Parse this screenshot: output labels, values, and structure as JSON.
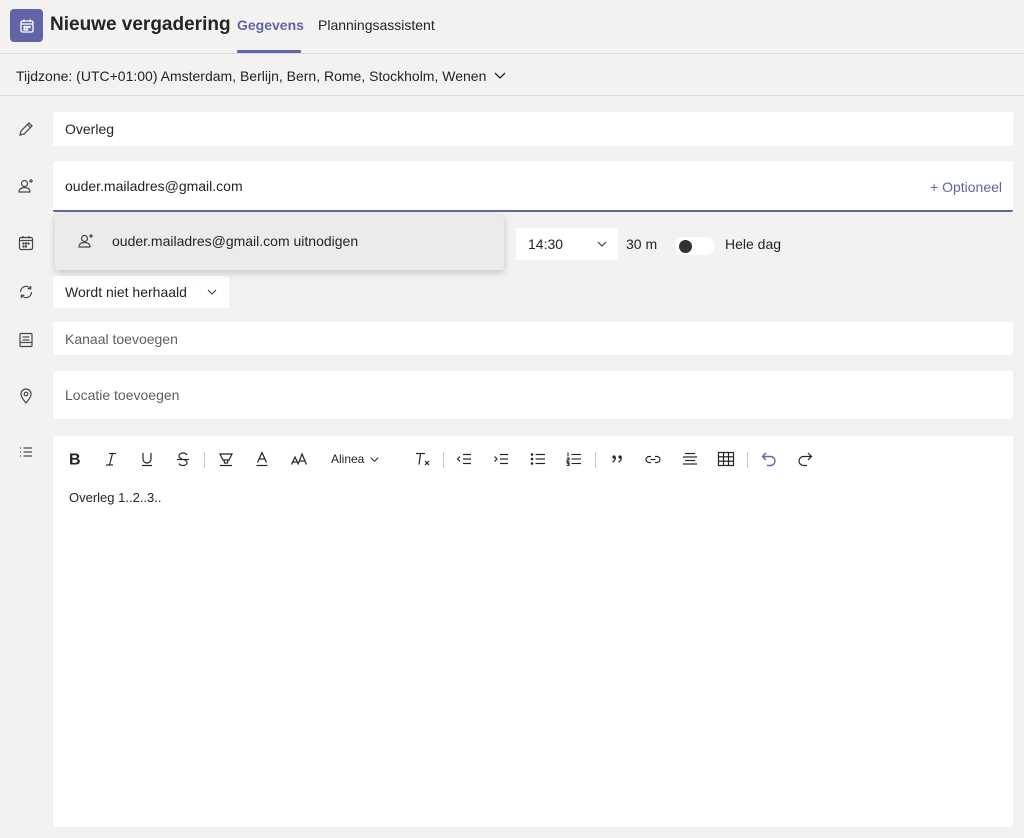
{
  "header": {
    "title": "Nieuwe vergadering",
    "tabs": [
      {
        "label": "Gegevens",
        "active": true
      },
      {
        "label": "Planningsassistent",
        "active": false
      }
    ],
    "accent": "#6264a7"
  },
  "timezone": {
    "label": "Tijdzone: (UTC+01:00) Amsterdam, Berlijn, Bern, Rome, Stockholm, Wenen"
  },
  "form": {
    "title_value": "Overleg",
    "attendees_value": "ouder.mailadres@gmail.com",
    "optional_link": "+ Optioneel",
    "suggestion": "ouder.mailadres@gmail.com uitnodigen",
    "end_time": "14:30",
    "duration": "30 m",
    "all_day_label": "Hele dag",
    "all_day_on": false,
    "repeat": "Wordt niet herhaald",
    "channel_placeholder": "Kanaal toevoegen",
    "location_placeholder": "Locatie toevoegen"
  },
  "editor": {
    "paragraph_style": "Alinea",
    "body": "Overleg 1..2..3.."
  },
  "icons": {
    "app": "calendar-icon",
    "title_row": "pencil-icon",
    "attendees_row": "add-person-icon",
    "date_row": "calendar-icon",
    "repeat_row": "repeat-icon",
    "channel_row": "channel-icon",
    "location_row": "location-pin-icon",
    "details_row": "list-icon"
  }
}
